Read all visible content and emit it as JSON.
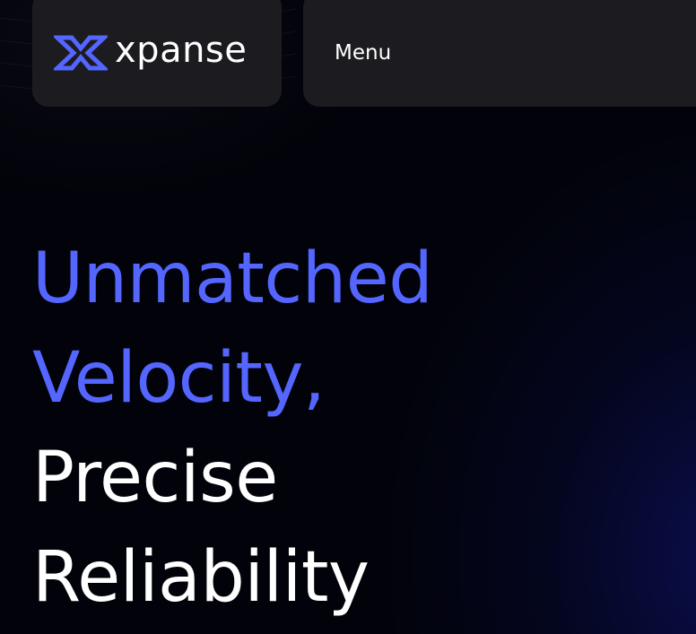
{
  "brand": {
    "logo_icon": "x-logo-icon",
    "name": "xpanse",
    "accent_color": "#5466ff"
  },
  "nav": {
    "menu_label": "Menu"
  },
  "hero": {
    "line1": "Unmatched",
    "line2": "Velocity,",
    "line3": "Precise",
    "line4": "Reliability",
    "accent_color": "#5466ff",
    "text_color": "#ffffff"
  },
  "theme": {
    "background": "#02030a",
    "card_background": "#1c1c20",
    "glow_color": "#0c1058"
  }
}
